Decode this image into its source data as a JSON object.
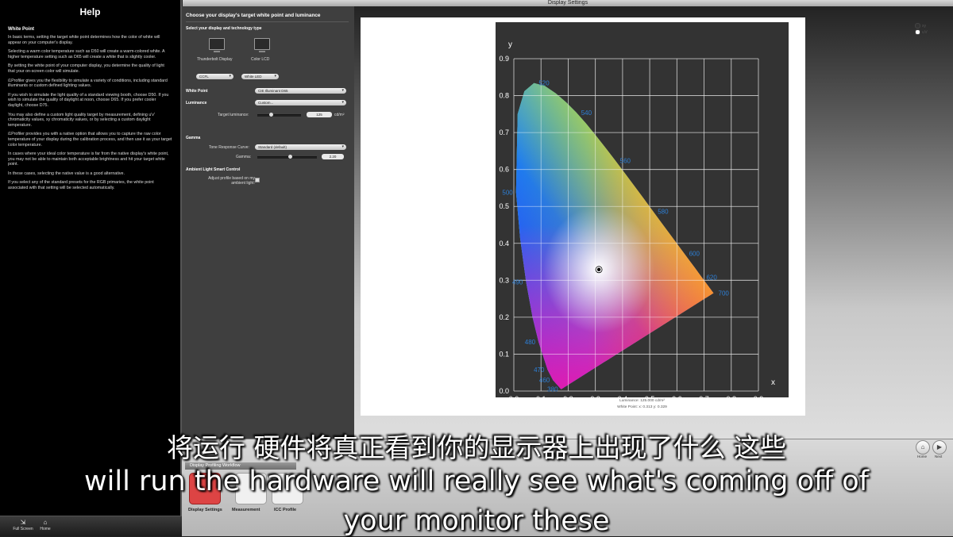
{
  "window": {
    "title": "Display Settings"
  },
  "help": {
    "title": "Help",
    "section": "White Point",
    "paragraphs": [
      "In basic terms, setting the target white point determines how the color of white will appear on your computer's display.",
      "Selecting a warm color temperature such as D50 will create a warm-colored white. A higher temperature setting such as D65 will create a white that is slightly cooler.",
      "By setting the white point of your computer display, you determine the quality of light that your on-screen color will simulate.",
      "i1Profiler gives you the flexibility to simulate a variety of conditions, including standard illuminants or custom defined lighting values.",
      "If you wish to simulate the light quality of a standard viewing booth, choose D50. If you wish to simulate the quality of daylight at noon, choose D65. If you prefer cooler daylight, choose D75.",
      "You may also define a custom light quality target by measurement, defining u'v' chromaticity values, xy chromaticity values, or by selecting a custom daylight temperature.",
      "i1Profiler provides you with a native option that allows you to capture the raw color temperature of your display during the calibration process, and then use it as your target color temperature.",
      "In cases where your ideal color temperature is far from the native display's white point, you may not be able to maintain both acceptable brightness and hit your target white point.",
      "In these cases, selecting the native value is a good alternative.",
      "If you select any of the standard presets for the RGB primaries, the white point associated with that setting will be selected automatically."
    ],
    "footer": {
      "fullscreen": "Full Screen",
      "home": "Home"
    }
  },
  "settings": {
    "heading": "Choose your display's target white point and luminance",
    "select_label": "Select your display and technology type",
    "displays": [
      "Thunderbolt Display",
      "Color LCD"
    ],
    "tech": [
      "CCFL",
      "White LED"
    ],
    "white_point_label": "White Point",
    "white_point_value": "CIE Illuminant D65",
    "luminance_label": "Luminance",
    "luminance_value": "Custom...",
    "target_luminance_label": "Target luminance:",
    "target_luminance_value": "125",
    "target_luminance_unit": "cd/m²",
    "luminance_fraction": 0.3,
    "gamma_label": "Gamma",
    "trc_label": "Tone Response Curve:",
    "trc_value": "Standard (default)",
    "gamma_field_label": "Gamma:",
    "gamma_value": "2.20",
    "gamma_fraction": 0.55,
    "ambient_label": "Ambient Light Smart Control",
    "ambient_text": "Adjust profile based on my ambient light:"
  },
  "chart_data": {
    "type": "scatter",
    "title": "",
    "xlabel": "x",
    "ylabel": "y",
    "xlim": [
      0,
      0.9
    ],
    "ylim": [
      0,
      0.9
    ],
    "xticks": [
      "0.0",
      "0.1",
      "0.2",
      "0.3",
      "0.4",
      "0.5",
      "0.6",
      "0.7",
      "0.8",
      "0.9"
    ],
    "yticks": [
      "0.0",
      "0.1",
      "0.2",
      "0.3",
      "0.4",
      "0.5",
      "0.6",
      "0.7",
      "0.8",
      "0.9"
    ],
    "grid": true,
    "locus_labels": [
      {
        "nm": "520",
        "x": 0.074,
        "y": 0.834
      },
      {
        "nm": "540",
        "x": 0.23,
        "y": 0.754
      },
      {
        "nm": "560",
        "x": 0.373,
        "y": 0.624
      },
      {
        "nm": "580",
        "x": 0.512,
        "y": 0.487
      },
      {
        "nm": "600",
        "x": 0.627,
        "y": 0.373
      },
      {
        "nm": "620",
        "x": 0.691,
        "y": 0.308
      },
      {
        "nm": "700",
        "x": 0.735,
        "y": 0.265
      },
      {
        "nm": "500",
        "x": 0.008,
        "y": 0.538
      },
      {
        "nm": "490",
        "x": 0.045,
        "y": 0.295
      },
      {
        "nm": "480",
        "x": 0.091,
        "y": 0.133
      },
      {
        "nm": "470",
        "x": 0.124,
        "y": 0.058
      },
      {
        "nm": "460",
        "x": 0.144,
        "y": 0.03
      },
      {
        "nm": "380",
        "x": 0.174,
        "y": 0.005
      }
    ],
    "white_point": {
      "x": 0.313,
      "y": 0.329
    },
    "luminance_caption": "Luminance: 125.000 cd/m²",
    "white_point_caption": "White Point:  x: 0.313  y: 0.329"
  },
  "radio": {
    "options": [
      "xy",
      "u'v'"
    ],
    "selected": 0
  },
  "workflow": {
    "title": "Display Profiling Workflow",
    "steps": [
      "Display Settings",
      "Measurement",
      "ICC Profile"
    ],
    "nav": [
      "Home",
      "Next"
    ]
  },
  "subtitles": {
    "zh": "将运行 硬件将真正看到你的显示器上出现了什么 这些",
    "en1": "will run the hardware will really see what's coming off of",
    "en2": "your monitor these"
  }
}
